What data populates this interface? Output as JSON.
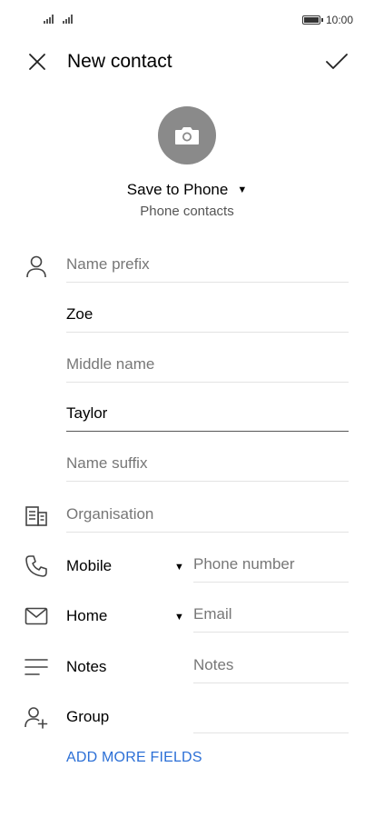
{
  "status_bar": {
    "time": "10:00"
  },
  "header": {
    "title": "New contact"
  },
  "account": {
    "save_to": "Save to Phone",
    "subtitle": "Phone contacts"
  },
  "name_fields": {
    "prefix_placeholder": "Name prefix",
    "first_name_value": "Zoe",
    "middle_placeholder": "Middle name",
    "last_name_value": "Taylor",
    "suffix_placeholder": "Name suffix"
  },
  "organisation": {
    "placeholder": "Organisation"
  },
  "phone": {
    "type_label": "Mobile",
    "placeholder": "Phone number"
  },
  "email": {
    "type_label": "Home",
    "placeholder": "Email"
  },
  "notes": {
    "label": "Notes",
    "placeholder": "Notes"
  },
  "group": {
    "label": "Group",
    "value": ""
  },
  "add_more_label": "ADD MORE FIELDS",
  "colors": {
    "accent": "#2b6fd6",
    "avatar_bg": "#8a8a8a"
  },
  "icons": [
    "close-icon",
    "check-icon",
    "camera-icon",
    "person-icon",
    "organisation-icon",
    "phone-icon",
    "email-icon",
    "notes-icon",
    "group-icon",
    "caret-down-icon"
  ]
}
